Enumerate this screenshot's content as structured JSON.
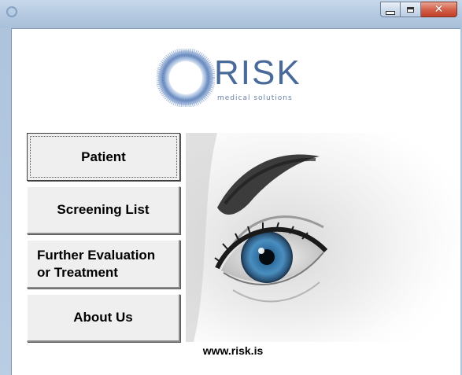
{
  "window": {
    "app_icon": "app-icon",
    "controls": {
      "minimize": "minimize-icon",
      "maximize": "maximize-icon",
      "close": "close-icon"
    }
  },
  "logo": {
    "name": "RISK",
    "tagline": "medical solutions"
  },
  "nav": {
    "items": [
      {
        "label": "Patient"
      },
      {
        "label": "Screening List"
      },
      {
        "label": "Further Evaluation\nor Treatment"
      },
      {
        "label": "About Us"
      }
    ]
  },
  "footer": {
    "website": "www.risk.is"
  },
  "colors": {
    "brand": "#4a6a9a",
    "button_face": "#efefef"
  }
}
